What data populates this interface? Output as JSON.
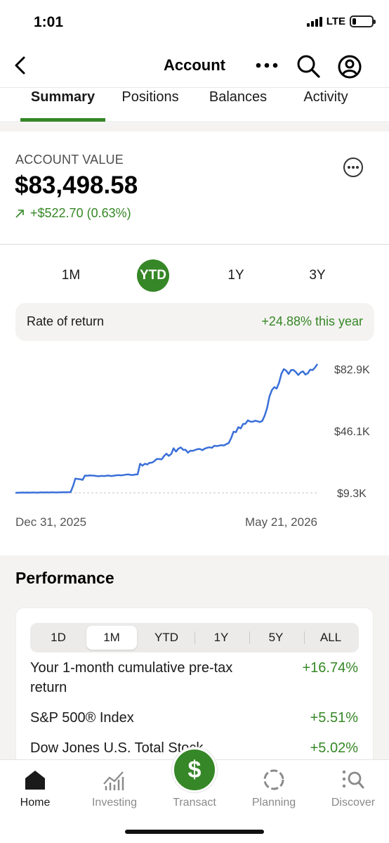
{
  "status": {
    "time": "1:01",
    "network": "LTE"
  },
  "header": {
    "title": "Account"
  },
  "tabs": [
    "Summary",
    "Positions",
    "Balances",
    "Activity"
  ],
  "account": {
    "label": "ACCOUNT VALUE",
    "value": "$83,498.58",
    "change": "+$522.70 (0.63%)"
  },
  "periods": [
    "1M",
    "YTD",
    "1Y",
    "3Y"
  ],
  "active_period": "YTD",
  "rate": {
    "label": "Rate of return",
    "value": "+24.88% this year"
  },
  "chart_data": {
    "type": "line",
    "x_start_label": "Dec 31, 2025",
    "x_end_label": "May 21, 2026",
    "y_tick_labels": [
      "$82.9K",
      "$46.1K",
      "$9.3K"
    ],
    "ylim": [
      9.3,
      82.9
    ],
    "color": "#3a6fd8",
    "baseline": 9.3,
    "values": [
      9.3,
      9.4,
      9.4,
      9.5,
      9.4,
      9.5,
      9.4,
      9.5,
      9.5,
      9.4,
      9.5,
      9.6,
      9.5,
      9.6,
      9.5,
      9.6,
      9.6,
      9.5,
      9.6,
      9.6,
      9.7,
      9.6,
      9.7,
      9.7,
      13.2,
      17.8,
      17.6,
      17.4,
      17.0,
      19.6,
      19.5,
      19.7,
      19.6,
      19.5,
      19.3,
      19.2,
      19.4,
      19.3,
      19.5,
      19.6,
      19.3,
      19.5,
      19.7,
      19.9,
      19.7,
      19.9,
      20.1,
      20.3,
      20.0,
      19.9,
      20.2,
      20.3,
      26.6,
      25.5,
      26.6,
      26.2,
      27.2,
      27.3,
      28.2,
      29.5,
      29.4,
      29.2,
      31.2,
      32.6,
      31.3,
      32.4,
      35.8,
      33.9,
      35.6,
      36.3,
      34.9,
      34.9,
      33.2,
      34.4,
      34.3,
      34.8,
      35.3,
      35.4,
      34.7,
      35.6,
      36.1,
      36.4,
      36.1,
      37.3,
      37.1,
      37.4,
      37.7,
      37.5,
      38.3,
      38.9,
      41.8,
      45.7,
      45.4,
      48.4,
      47.6,
      50.3,
      50.4,
      52.4,
      51.7,
      51.6,
      52.2,
      51.9,
      51.4,
      52.1,
      55.2,
      59.6,
      66.6,
      70.4,
      72.2,
      71.3,
      74.8,
      80.2,
      82.9,
      82.0,
      80.0,
      82.3,
      82.4,
      81.2,
      79.4,
      80.9,
      81.6,
      79.7,
      80.4,
      82.6,
      82.3,
      83.8,
      85.9
    ]
  },
  "performance": {
    "title": "Performance",
    "segments": [
      "1D",
      "1M",
      "YTD",
      "1Y",
      "5Y",
      "ALL"
    ],
    "active_segment": "1M",
    "rows": [
      {
        "label": "Your 1-month cumulative pre-tax return",
        "value": "+16.74%"
      },
      {
        "label": "S&P 500® Index",
        "value": "+5.51%"
      },
      {
        "label": "Dow Jones U.S. Total Stock",
        "value": "+5.02%"
      }
    ]
  },
  "bottom_nav": {
    "items": [
      "Home",
      "Investing",
      "Transact",
      "Planning",
      "Discover"
    ],
    "active": "Home",
    "transact_symbol": "$"
  },
  "colors": {
    "accent": "#368727",
    "line": "#3a6fd8",
    "muted": "#8a8a8a"
  }
}
